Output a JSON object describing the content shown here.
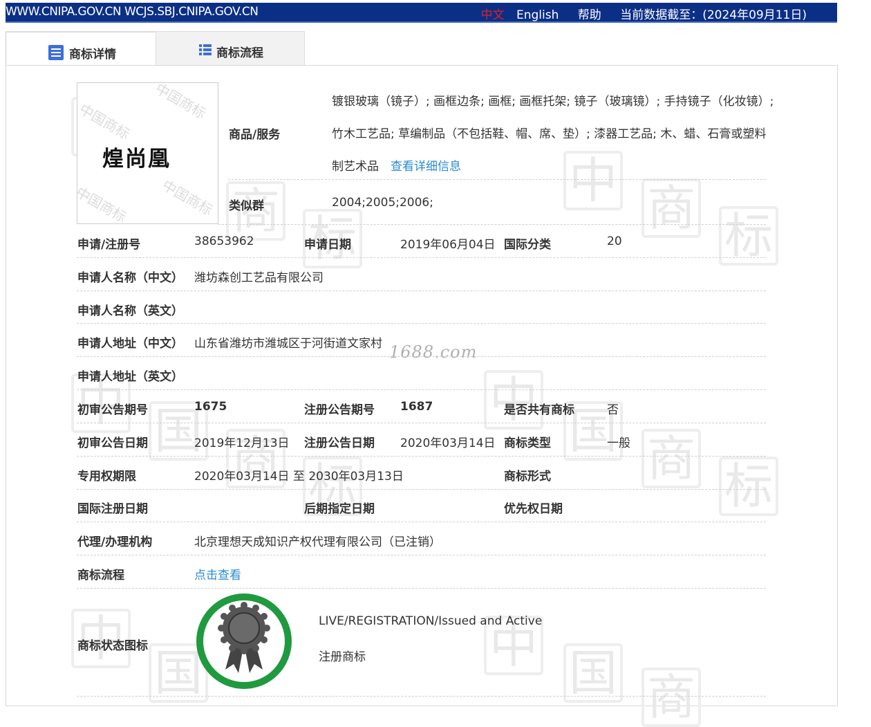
{
  "topbar": {
    "domains": "WWW.CNIPA.GOV.CN WCJS.SBJ.CNIPA.GOV.CN",
    "lang_zh": "中文",
    "lang_en": "English",
    "help": "帮助",
    "data_as_of": "当前数据截至：(2024年09月11日)"
  },
  "tabs": [
    {
      "label": "商标详情",
      "icon": "list-detail-icon",
      "active": true
    },
    {
      "label": "商标流程",
      "icon": "list-icon",
      "active": false
    }
  ],
  "logo": {
    "text": "煌尚凰",
    "watermark": "中国商标"
  },
  "goods": {
    "label": "商品/服务",
    "line1": "镀银玻璃（镜子）; 画框边条; 画框; 画框托架; 镜子（玻璃镜）; 手持镜子（化妆镜）;",
    "line2": "竹木工艺品; 草编制品（不包括鞋、帽、席、垫）; 漆器工艺品; 木、蜡、石膏或塑料",
    "line3": "制艺术品",
    "detail_link": "查看详细信息"
  },
  "similar_group": {
    "label": "类似群",
    "value": "2004;2005;2006;"
  },
  "fields": {
    "reg_no_label": "申请/注册号",
    "reg_no": "38653962",
    "apply_date_label": "申请日期",
    "apply_date": "2019年06月04日",
    "intl_class_label": "国际分类",
    "intl_class": "20",
    "applicant_cn_label": "申请人名称（中文）",
    "applicant_cn": "潍坊森创工艺品有限公司",
    "applicant_en_label": "申请人名称（英文）",
    "applicant_en": "",
    "address_cn_label": "申请人地址（中文）",
    "address_cn": "山东省潍坊市潍城区于河街道文家村",
    "address_en_label": "申请人地址（英文）",
    "address_en": "",
    "prelim_issue_label": "初审公告期号",
    "prelim_issue": "1675",
    "reg_issue_label": "注册公告期号",
    "reg_issue": "1687",
    "shared_label": "是否共有商标",
    "shared": "否",
    "prelim_date_label": "初审公告日期",
    "prelim_date": "2019年12月13日",
    "reg_date_label": "注册公告日期",
    "reg_date": "2020年03月14日",
    "type_label": "商标类型",
    "type": "一般",
    "exclusive_label": "专用权期限",
    "exclusive": "2020年03月14日 至 2030年03月13日",
    "form_label": "商标形式",
    "form": "",
    "intl_reg_date_label": "国际注册日期",
    "intl_reg_date": "",
    "later_designation_label": "后期指定日期",
    "later_designation": "",
    "priority_label": "优先权日期",
    "priority": "",
    "agent_label": "代理/办理机构",
    "agent": "北京理想天成知识产权代理有限公司（已注销）",
    "process_label": "商标流程",
    "process_link": "点击查看",
    "status_label": "商标状态图标",
    "status_en": "LIVE/REGISTRATION/Issued and Active",
    "status_cn": "注册商标"
  },
  "watermark_site": "1688.com",
  "colors": {
    "topbar": "#0c2f86",
    "link": "#2a8bd0",
    "seal_green": "#1f9a3f",
    "lang_active": "#e02020"
  }
}
